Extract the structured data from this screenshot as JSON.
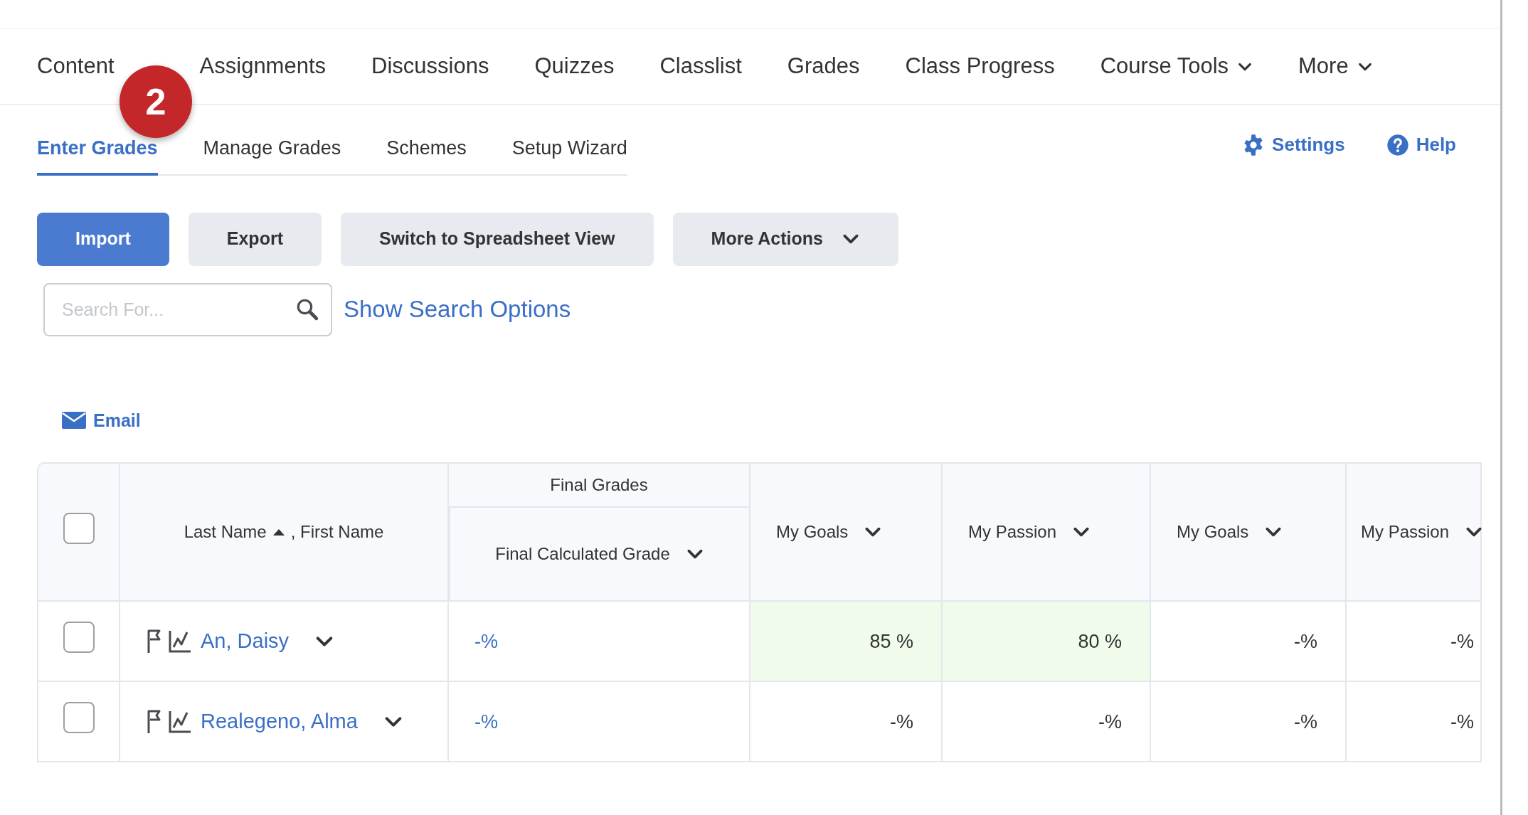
{
  "course_nav": [
    {
      "label": "Content",
      "dropdown": false
    },
    {
      "label": "Assignments",
      "dropdown": false
    },
    {
      "label": "Discussions",
      "dropdown": false
    },
    {
      "label": "Quizzes",
      "dropdown": false
    },
    {
      "label": "Classlist",
      "dropdown": false
    },
    {
      "label": "Grades",
      "dropdown": false
    },
    {
      "label": "Class Progress",
      "dropdown": false
    },
    {
      "label": "Course Tools",
      "dropdown": true
    },
    {
      "label": "More",
      "dropdown": true
    }
  ],
  "step_badge": "2",
  "sub_tabs": [
    {
      "label": "Enter Grades",
      "selected": true
    },
    {
      "label": "Manage Grades",
      "selected": false
    },
    {
      "label": "Schemes",
      "selected": false
    },
    {
      "label": "Setup Wizard",
      "selected": false
    }
  ],
  "header_links": [
    {
      "label": "Settings",
      "kind": "settings"
    },
    {
      "label": "Help",
      "kind": "help"
    }
  ],
  "actions": [
    {
      "label": "Import",
      "kind": "primary"
    },
    {
      "label": "Export",
      "kind": "plain"
    },
    {
      "label": "Switch to Spreadsheet View",
      "kind": "plain"
    },
    {
      "label": "More Actions",
      "kind": "menu"
    }
  ],
  "search": {
    "placeholder": "Search For...",
    "options_link": "Show Search Options"
  },
  "email_link": "Email",
  "table": {
    "select_all_checked": false,
    "name_column": {
      "last": "Last Name",
      "first": ", First Name",
      "sorted_ascending": true
    },
    "group_heading": "Final Grades",
    "columns": [
      {
        "label": "Final Calculated Grade"
      },
      {
        "label": "My Goals"
      },
      {
        "label": "My Passion"
      },
      {
        "label": "My Goals"
      },
      {
        "label": "My Passion"
      }
    ],
    "rows": [
      {
        "checked": false,
        "name": "An, Daisy",
        "cells": [
          {
            "text": "-%",
            "kind": "link",
            "highlighted": false
          },
          {
            "text": "85 %",
            "kind": "plain",
            "highlighted": true
          },
          {
            "text": "80 %",
            "kind": "plain",
            "highlighted": true
          },
          {
            "text": "-%",
            "kind": "plain",
            "highlighted": false
          },
          {
            "text": "-%",
            "kind": "plain",
            "highlighted": false
          }
        ]
      },
      {
        "checked": false,
        "name": "Realegeno, Alma",
        "cells": [
          {
            "text": "-%",
            "kind": "link",
            "highlighted": false
          },
          {
            "text": "-%",
            "kind": "plain",
            "highlighted": false
          },
          {
            "text": "-%",
            "kind": "plain",
            "highlighted": false
          },
          {
            "text": "-%",
            "kind": "plain",
            "highlighted": false
          },
          {
            "text": "-%",
            "kind": "plain",
            "highlighted": false
          }
        ]
      }
    ]
  }
}
